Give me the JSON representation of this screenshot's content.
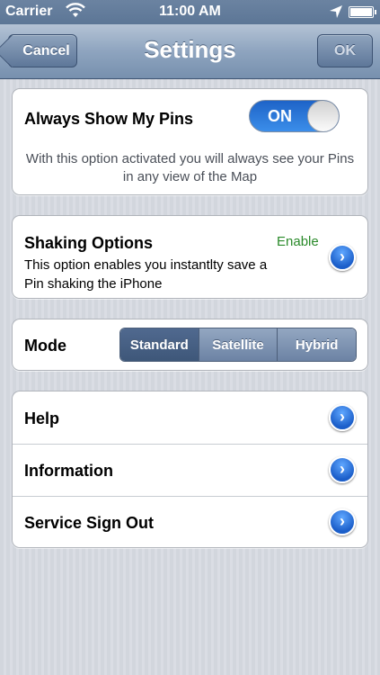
{
  "status_bar": {
    "carrier": "Carrier",
    "time": "11:00 AM"
  },
  "nav": {
    "title": "Settings",
    "cancel_label": "Cancel",
    "ok_label": "OK"
  },
  "pins_section": {
    "label": "Always Show My Pins",
    "toggle_label": "ON",
    "toggle_on": true,
    "description": "With this option activated you will always see your Pins in any view of the Map"
  },
  "shaking_section": {
    "label": "Shaking Options",
    "status": "Enable",
    "status_color": "#2a8a2a",
    "description_line1": "This option enables you instantlty save a",
    "description_line2": "Pin shaking the iPhone"
  },
  "mode_section": {
    "label": "Mode",
    "options": [
      "Standard",
      "Satellite",
      "Hybrid"
    ],
    "selected": "Standard"
  },
  "menu": {
    "help": "Help",
    "information": "Information",
    "sign_out": "Service Sign Out"
  },
  "colors": {
    "accent": "#2f7ae5",
    "nav": "#7790ae"
  },
  "icons": [
    "wifi-icon",
    "location-arrow-icon",
    "battery-icon",
    "disclosure-chevron-icon"
  ]
}
